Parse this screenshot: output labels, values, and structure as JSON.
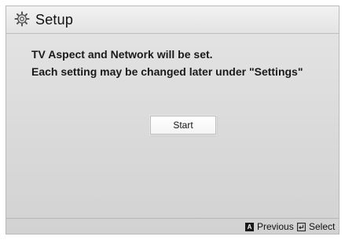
{
  "header": {
    "title": "Setup",
    "icon": "gear-icon"
  },
  "message": {
    "line1": "TV Aspect and Network will be set.",
    "line2": "Each setting may be changed later under \"Settings\""
  },
  "actions": {
    "start_label": "Start"
  },
  "footer": {
    "previous_key": "A",
    "previous_label": "Previous",
    "select_icon": "enter-icon",
    "select_label": "Select"
  },
  "colors": {
    "background": "#dcdcdc",
    "title_bar": "#e9e9e9",
    "button": "#ffffff",
    "text": "#111111"
  }
}
